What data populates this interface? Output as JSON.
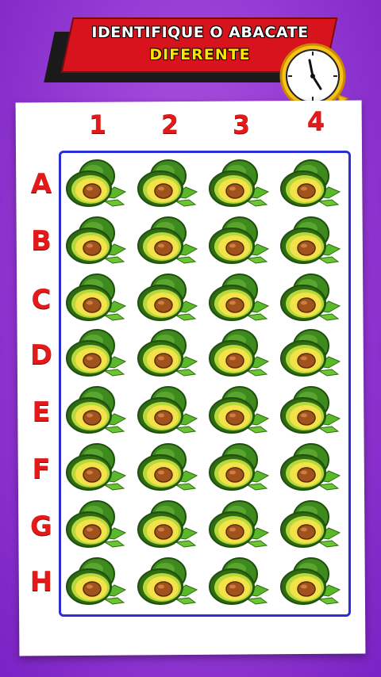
{
  "header": {
    "line1": "IDENTIFIQUE O ABACATE",
    "line2": "DIFERENTE"
  },
  "grid": {
    "columns": [
      "1",
      "2",
      "3",
      "4"
    ],
    "rows": [
      "A",
      "B",
      "C",
      "D",
      "E",
      "F",
      "G",
      "H"
    ],
    "item_icon": "avocado-icon"
  },
  "colors": {
    "background": "#9a3fd6",
    "banner_red": "#d7141d",
    "banner_yellow_text": "#ffe600",
    "label_red": "#e41a1a",
    "grid_border": "#2b2fd8",
    "avocado_skin": "#3f8a1e",
    "avocado_flesh": "#f3e24a",
    "avocado_pit": "#a0521c"
  }
}
